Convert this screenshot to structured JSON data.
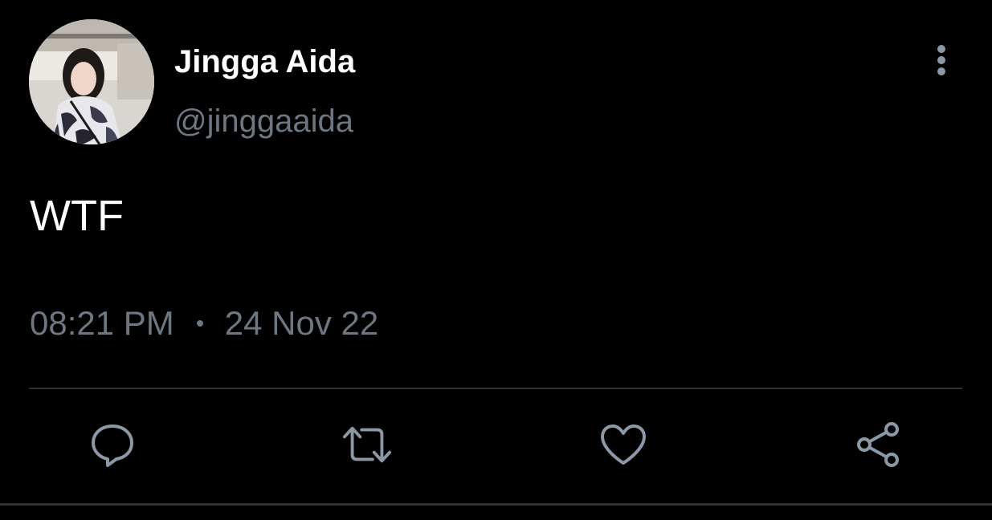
{
  "tweet": {
    "author": {
      "display_name": "Jingga Aida",
      "handle": "@jinggaaida",
      "avatar_icon": "profile-photo"
    },
    "text": "WTF",
    "time": "08:21 PM",
    "separator": "·",
    "date": "24 Nov 22"
  },
  "actions": [
    {
      "name": "reply",
      "icon": "speech-bubble-icon"
    },
    {
      "name": "retweet",
      "icon": "retweet-arrows-icon"
    },
    {
      "name": "like",
      "icon": "heart-icon"
    },
    {
      "name": "share",
      "icon": "share-nodes-icon"
    }
  ],
  "colors": {
    "background": "#000000",
    "primary_text": "#ffffff",
    "secondary_text": "#6e7781",
    "divider": "#2f3336",
    "icon": "#8b98a5"
  }
}
